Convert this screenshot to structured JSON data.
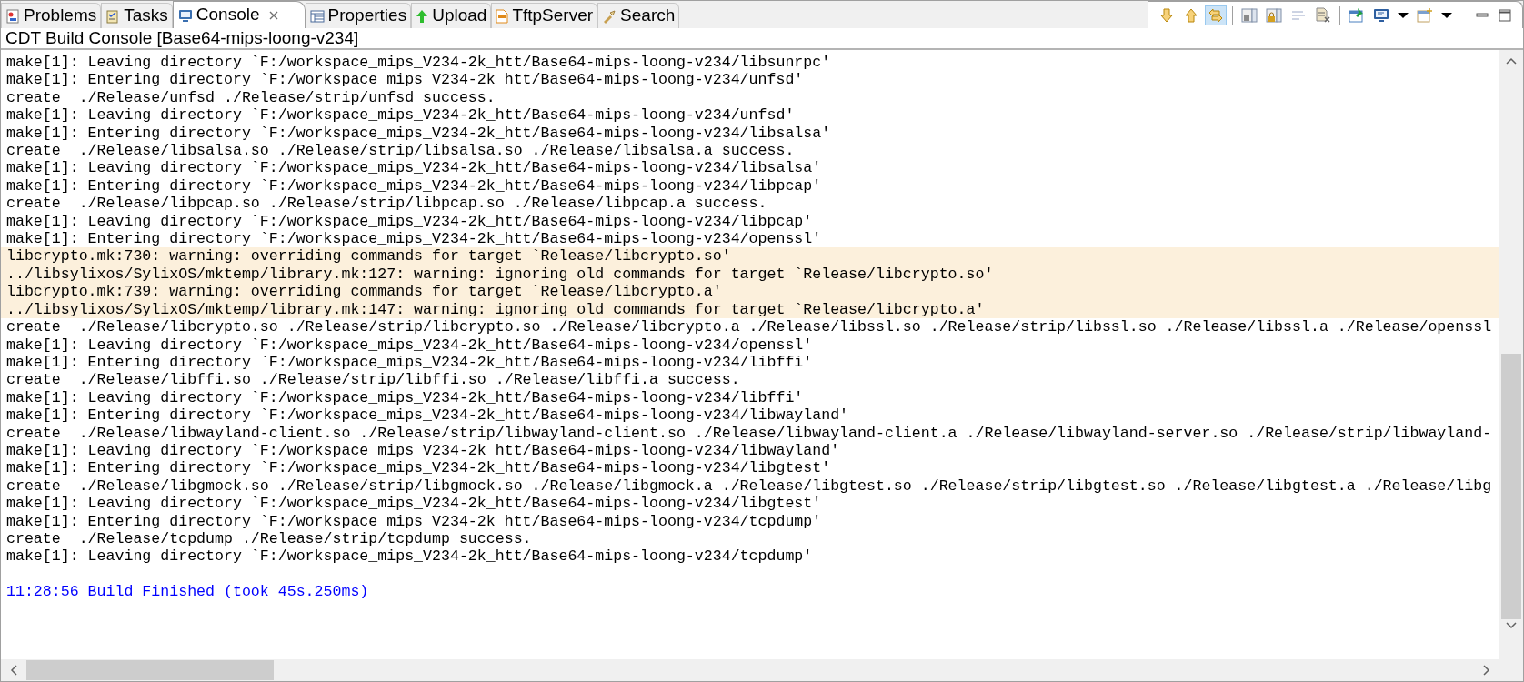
{
  "tabs": [
    {
      "label": "Problems",
      "kind": "problems",
      "selected": false
    },
    {
      "label": "Tasks",
      "kind": "tasks",
      "selected": false
    },
    {
      "label": "Console",
      "kind": "console",
      "selected": true
    },
    {
      "label": "Properties",
      "kind": "properties",
      "selected": false
    },
    {
      "label": "Upload",
      "kind": "upload",
      "selected": false
    },
    {
      "label": "TftpServer",
      "kind": "tftp",
      "selected": false
    },
    {
      "label": "Search",
      "kind": "search",
      "selected": false
    }
  ],
  "toolbar": [
    {
      "kind": "down",
      "pressed": false
    },
    {
      "kind": "up",
      "pressed": false
    },
    {
      "kind": "link",
      "pressed": true
    },
    {
      "kind": "sep"
    },
    {
      "kind": "save",
      "pressed": false
    },
    {
      "kind": "lock",
      "pressed": false
    },
    {
      "kind": "wrap",
      "pressed": false
    },
    {
      "kind": "clear",
      "pressed": false
    },
    {
      "kind": "sep"
    },
    {
      "kind": "pin",
      "pressed": false
    },
    {
      "kind": "display",
      "pressed": false
    },
    {
      "kind": "caret",
      "pressed": false
    },
    {
      "kind": "newconsole",
      "pressed": false
    },
    {
      "kind": "caret",
      "pressed": false
    },
    {
      "kind": "minimize",
      "pressed": false
    },
    {
      "kind": "maximize",
      "pressed": false
    }
  ],
  "console": {
    "title": "CDT Build Console [Base64-mips-loong-v234]",
    "lines": [
      {
        "kind": "normal",
        "text": "make[1]: Leaving directory `F:/workspace_mips_V234-2k_htt/Base64-mips-loong-v234/libsunrpc'"
      },
      {
        "kind": "normal",
        "text": "make[1]: Entering directory `F:/workspace_mips_V234-2k_htt/Base64-mips-loong-v234/unfsd'"
      },
      {
        "kind": "normal",
        "text": "create  ./Release/unfsd ./Release/strip/unfsd success."
      },
      {
        "kind": "normal",
        "text": "make[1]: Leaving directory `F:/workspace_mips_V234-2k_htt/Base64-mips-loong-v234/unfsd'"
      },
      {
        "kind": "normal",
        "text": "make[1]: Entering directory `F:/workspace_mips_V234-2k_htt/Base64-mips-loong-v234/libsalsa'"
      },
      {
        "kind": "normal",
        "text": "create  ./Release/libsalsa.so ./Release/strip/libsalsa.so ./Release/libsalsa.a success."
      },
      {
        "kind": "normal",
        "text": "make[1]: Leaving directory `F:/workspace_mips_V234-2k_htt/Base64-mips-loong-v234/libsalsa'"
      },
      {
        "kind": "normal",
        "text": "make[1]: Entering directory `F:/workspace_mips_V234-2k_htt/Base64-mips-loong-v234/libpcap'"
      },
      {
        "kind": "normal",
        "text": "create  ./Release/libpcap.so ./Release/strip/libpcap.so ./Release/libpcap.a success."
      },
      {
        "kind": "normal",
        "text": "make[1]: Leaving directory `F:/workspace_mips_V234-2k_htt/Base64-mips-loong-v234/libpcap'"
      },
      {
        "kind": "normal",
        "text": "make[1]: Entering directory `F:/workspace_mips_V234-2k_htt/Base64-mips-loong-v234/openssl'"
      },
      {
        "kind": "warning",
        "text": "libcrypto.mk:730: warning: overriding commands for target `Release/libcrypto.so'"
      },
      {
        "kind": "warning",
        "text": "../libsylixos/SylixOS/mktemp/library.mk:127: warning: ignoring old commands for target `Release/libcrypto.so'"
      },
      {
        "kind": "warning",
        "text": "libcrypto.mk:739: warning: overriding commands for target `Release/libcrypto.a'"
      },
      {
        "kind": "warning",
        "text": "../libsylixos/SylixOS/mktemp/library.mk:147: warning: ignoring old commands for target `Release/libcrypto.a'"
      },
      {
        "kind": "normal",
        "text": "create  ./Release/libcrypto.so ./Release/strip/libcrypto.so ./Release/libcrypto.a ./Release/libssl.so ./Release/strip/libssl.so ./Release/libssl.a ./Release/openssl"
      },
      {
        "kind": "normal",
        "text": "make[1]: Leaving directory `F:/workspace_mips_V234-2k_htt/Base64-mips-loong-v234/openssl'"
      },
      {
        "kind": "normal",
        "text": "make[1]: Entering directory `F:/workspace_mips_V234-2k_htt/Base64-mips-loong-v234/libffi'"
      },
      {
        "kind": "normal",
        "text": "create  ./Release/libffi.so ./Release/strip/libffi.so ./Release/libffi.a success."
      },
      {
        "kind": "normal",
        "text": "make[1]: Leaving directory `F:/workspace_mips_V234-2k_htt/Base64-mips-loong-v234/libffi'"
      },
      {
        "kind": "normal",
        "text": "make[1]: Entering directory `F:/workspace_mips_V234-2k_htt/Base64-mips-loong-v234/libwayland'"
      },
      {
        "kind": "normal",
        "text": "create  ./Release/libwayland-client.so ./Release/strip/libwayland-client.so ./Release/libwayland-client.a ./Release/libwayland-server.so ./Release/strip/libwayland-"
      },
      {
        "kind": "normal",
        "text": "make[1]: Leaving directory `F:/workspace_mips_V234-2k_htt/Base64-mips-loong-v234/libwayland'"
      },
      {
        "kind": "normal",
        "text": "make[1]: Entering directory `F:/workspace_mips_V234-2k_htt/Base64-mips-loong-v234/libgtest'"
      },
      {
        "kind": "normal",
        "text": "create  ./Release/libgmock.so ./Release/strip/libgmock.so ./Release/libgmock.a ./Release/libgtest.so ./Release/strip/libgtest.so ./Release/libgtest.a ./Release/libg"
      },
      {
        "kind": "normal",
        "text": "make[1]: Leaving directory `F:/workspace_mips_V234-2k_htt/Base64-mips-loong-v234/libgtest'"
      },
      {
        "kind": "normal",
        "text": "make[1]: Entering directory `F:/workspace_mips_V234-2k_htt/Base64-mips-loong-v234/tcpdump'"
      },
      {
        "kind": "normal",
        "text": "create  ./Release/tcpdump ./Release/strip/tcpdump success."
      },
      {
        "kind": "normal",
        "text": "make[1]: Leaving directory `F:/workspace_mips_V234-2k_htt/Base64-mips-loong-v234/tcpdump'"
      },
      {
        "kind": "status",
        "text": "11:28:56 Build Finished (took 45s.250ms)"
      }
    ]
  }
}
